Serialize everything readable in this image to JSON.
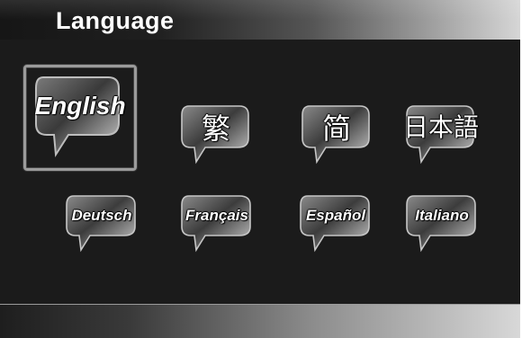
{
  "header": {
    "title": "Language"
  },
  "languages": {
    "english": "English",
    "traditional_chinese": "繁",
    "simplified_chinese": "简",
    "japanese": "日本語",
    "german": "Deutsch",
    "french": "Français",
    "spanish": "Español",
    "italian": "Italiano"
  },
  "selected": "english",
  "icon": "speech-bubble-icon"
}
